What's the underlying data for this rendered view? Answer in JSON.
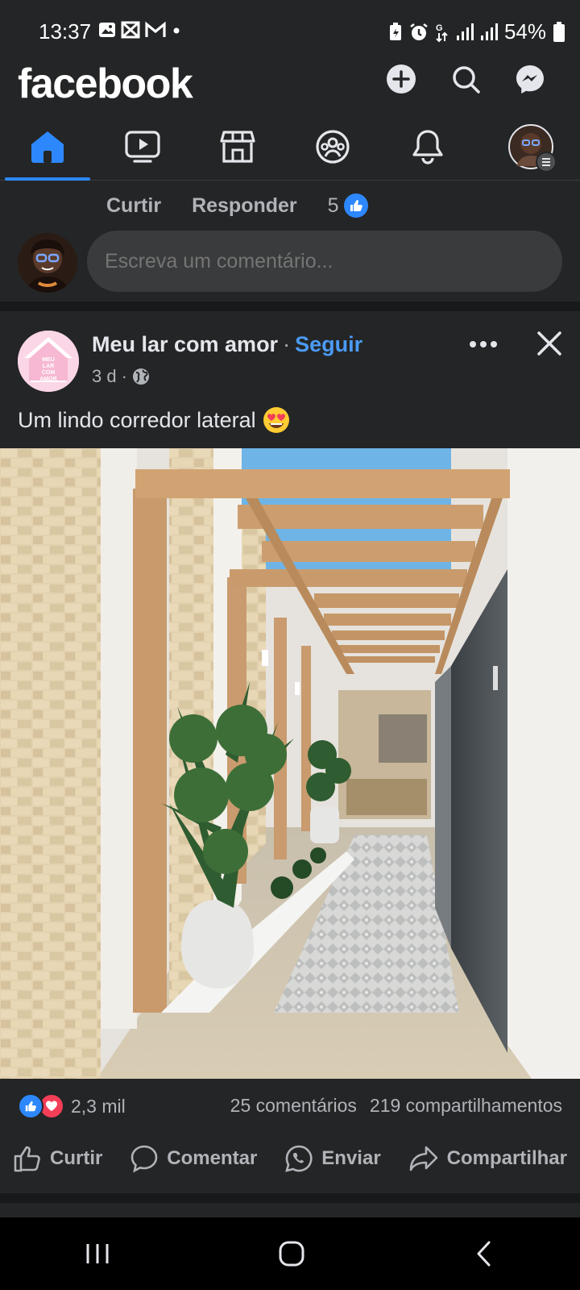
{
  "status_bar": {
    "time": "13:37",
    "battery": "54%",
    "icons": [
      "gallery-icon",
      "notification-icon",
      "gmail-icon",
      "dot-icon",
      "battery-saver-icon",
      "alarm-icon",
      "data-icon",
      "signal-icon",
      "signal-icon",
      "battery-icon"
    ]
  },
  "header": {
    "brand": "facebook",
    "buttons": [
      "add-icon",
      "search-icon",
      "messenger-icon"
    ]
  },
  "tabs": [
    {
      "name": "home",
      "active": true
    },
    {
      "name": "video",
      "active": false
    },
    {
      "name": "marketplace",
      "active": false
    },
    {
      "name": "groups",
      "active": false
    },
    {
      "name": "notifications",
      "active": false
    },
    {
      "name": "profile-menu",
      "active": false
    }
  ],
  "comment_section": {
    "like_label": "Curtir",
    "reply_label": "Responder",
    "like_count": "5",
    "input_placeholder": "Escreva um comentário..."
  },
  "post": {
    "page_name": "Meu lar com amor",
    "separator": "·",
    "follow_label": "Seguir",
    "time": "3 d",
    "audience_icon": "globe-icon",
    "caption": "Um lindo corredor lateral",
    "caption_emoji": "heart-eyes-emoji",
    "logo_text": "MEU LAR COM AMOR",
    "reaction_count": "2,3 mil",
    "comments": "25 comentários",
    "shares": "219 compartilhamentos",
    "actions": {
      "like": "Curtir",
      "comment": "Comentar",
      "send": "Enviar",
      "share": "Compartilhar"
    }
  },
  "colors": {
    "background": "#18191a",
    "card": "#242526",
    "accent": "#2d88ff",
    "follow": "#4a9bf5",
    "love": "#f33e58"
  }
}
